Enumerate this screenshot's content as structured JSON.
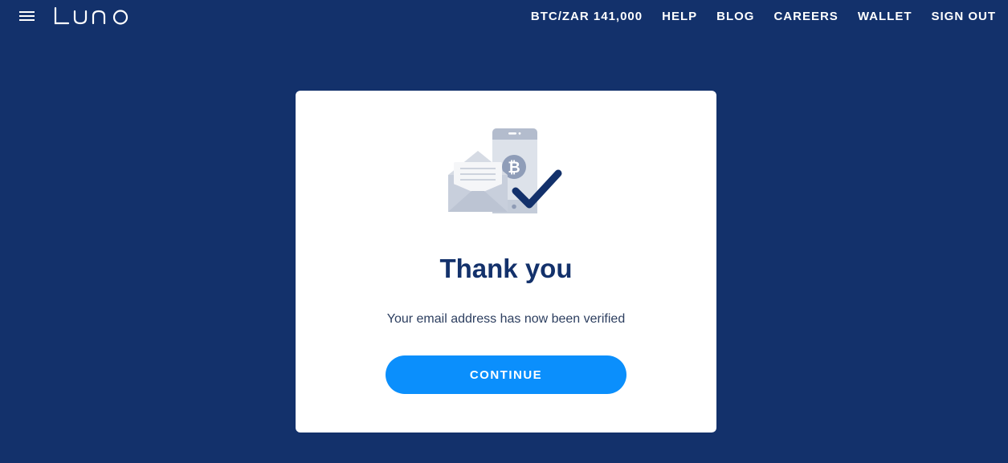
{
  "header": {
    "logo_text": "LUNO",
    "nav": [
      {
        "label": "BTC/ZAR 141,000"
      },
      {
        "label": "HELP"
      },
      {
        "label": "BLOG"
      },
      {
        "label": "CAREERS"
      },
      {
        "label": "WALLET"
      },
      {
        "label": "SIGN OUT"
      }
    ]
  },
  "card": {
    "illustration_icon": "email-verified-illustration",
    "title": "Thank you",
    "subtitle": "Your email address has now been verified",
    "continue_label": "CONTINUE"
  },
  "colors": {
    "background": "#13316b",
    "card": "#ffffff",
    "button": "#0b8ffc",
    "title": "#13316b"
  }
}
